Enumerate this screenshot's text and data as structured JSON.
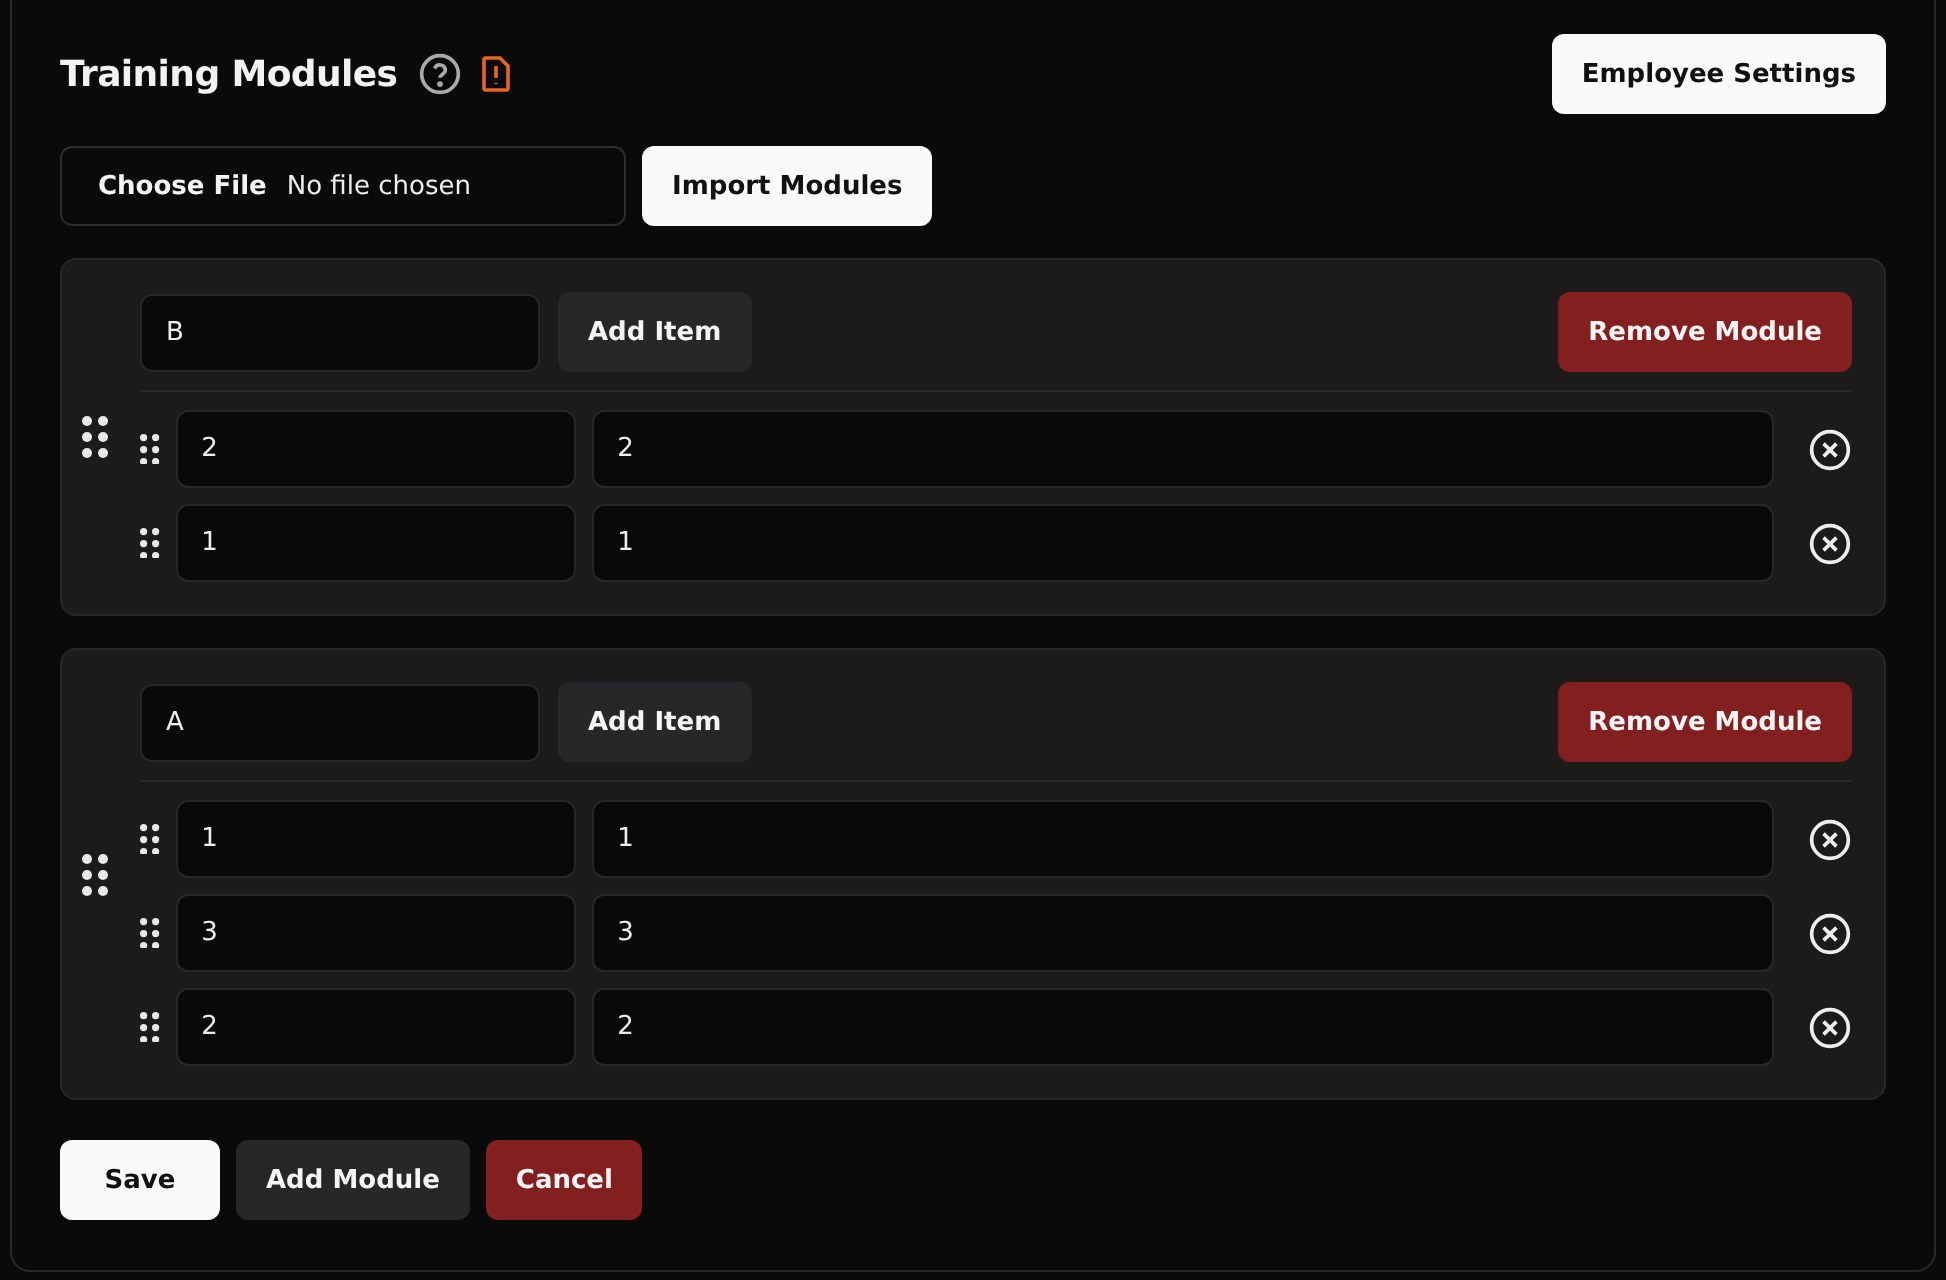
{
  "title": "Training Modules",
  "employee_settings_button": "Employee Settings",
  "file_input": {
    "button": "Choose File",
    "status": "No file chosen"
  },
  "import_button": "Import Modules",
  "modules": [
    {
      "name": "B",
      "add_item_button": "Add Item",
      "remove_button": "Remove Module",
      "items": [
        {
          "key": "2",
          "value": "2"
        },
        {
          "key": "1",
          "value": "1"
        }
      ]
    },
    {
      "name": "A",
      "add_item_button": "Add Item",
      "remove_button": "Remove Module",
      "items": [
        {
          "key": "1",
          "value": "1"
        },
        {
          "key": "3",
          "value": "3"
        },
        {
          "key": "2",
          "value": "2"
        }
      ]
    }
  ],
  "footer_buttons": [
    {
      "label": "Save",
      "kind": "primary"
    },
    {
      "label": "Add Module",
      "kind": "secondary"
    },
    {
      "label": "Cancel",
      "kind": "danger"
    }
  ]
}
